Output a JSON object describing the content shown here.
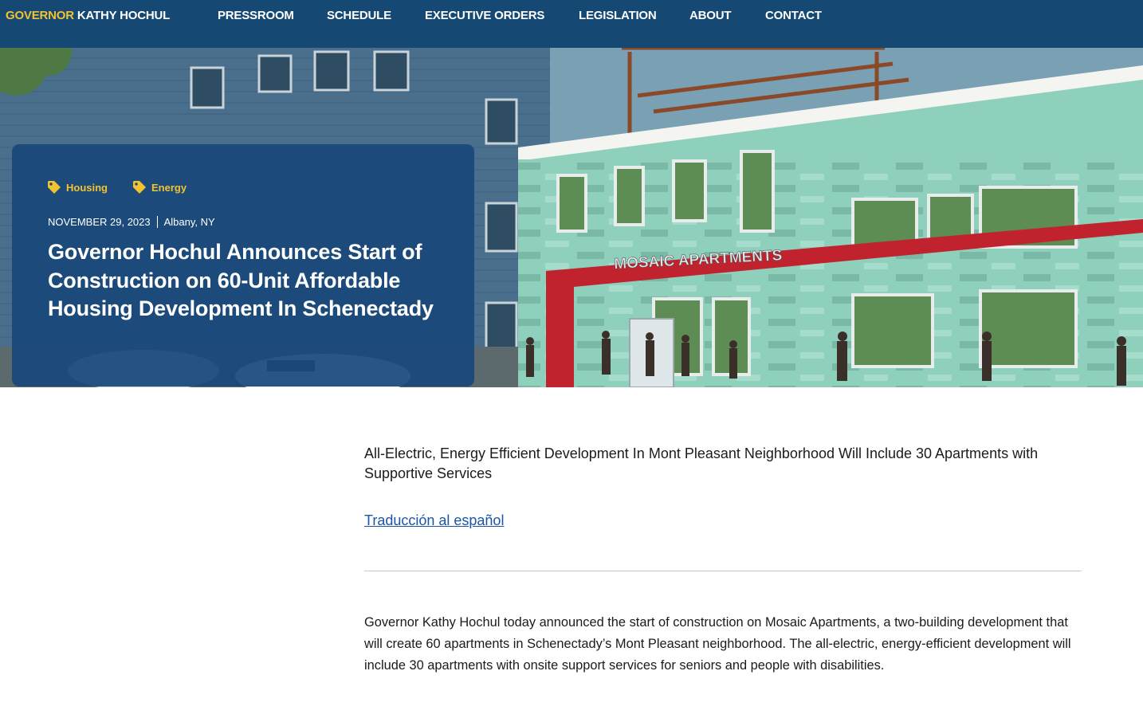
{
  "nav": {
    "brand_highlight": "GOVERNOR",
    "brand_name": "KATHY HOCHUL",
    "links": [
      "PRESSROOM",
      "SCHEDULE",
      "EXECUTIVE ORDERS",
      "LEGISLATION",
      "ABOUT",
      "CONTACT"
    ]
  },
  "hero": {
    "building_sign": "MOSAIC APARTMENTS",
    "tags": [
      "Housing",
      "Energy"
    ],
    "date": "NOVEMBER 29, 2023",
    "location": "Albany, NY",
    "headline": "Governor Hochul Announces Start of Construction on 60-Unit Affordable Housing Development In Schenectady"
  },
  "article": {
    "subtitle": "All-Electric, Energy Efficient Development In Mont Pleasant Neighborhood Will Include 30 Apartments with Supportive Services",
    "translation_link": "Traducción al español",
    "paragraph_1": "Governor Kathy Hochul today announced the start of construction on Mosaic Apartments, a two-building development that will create 60 apartments in Schenectady’s Mont Pleasant neighborhood. The all-electric, energy-efficient development will include 30 apartments with onsite support services for seniors and people with disabilities."
  },
  "colors": {
    "nav_bg": "#154973",
    "brand_gold": "#f2c230",
    "card_bg": "#19487a",
    "link_blue": "#1a55a8"
  },
  "icons": {
    "tag": "tag-icon"
  }
}
